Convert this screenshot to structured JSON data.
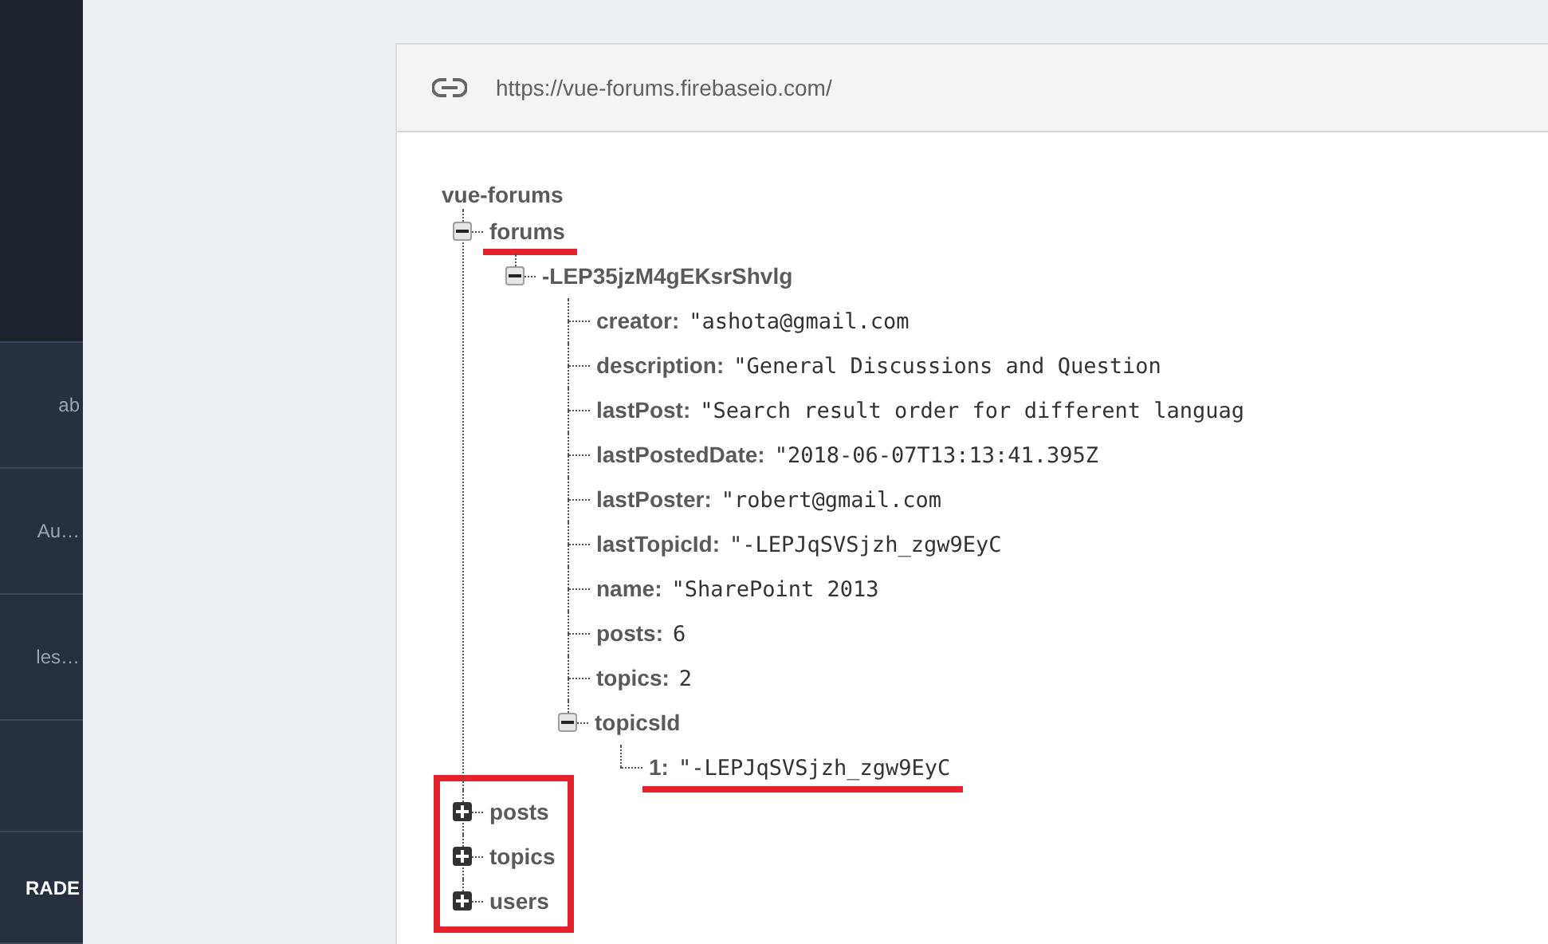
{
  "sidebar": {
    "items": [
      {
        "label": "ab",
        "kind": "link"
      },
      {
        "label": "Au…",
        "kind": "link"
      },
      {
        "label": "les…",
        "kind": "link"
      },
      {
        "label": "RADE",
        "kind": "action"
      }
    ]
  },
  "database": {
    "url": "https://vue-forums.firebaseio.com/",
    "tree": {
      "key": "vue-forums",
      "children": [
        {
          "key": "forums",
          "expanded": true,
          "underlined": true,
          "highlighted": false,
          "children": [
            {
              "key": "-LEP35jzM4gEKsrShvlg",
              "expanded": true,
              "underlined": false,
              "highlighted": false,
              "children": [
                {
                  "key": "creator:",
                  "value": "\"ashota@gmail.com",
                  "underlined": false,
                  "highlighted": false
                },
                {
                  "key": "description:",
                  "value": "\"General Discussions and Question",
                  "underlined": false,
                  "highlighted": false
                },
                {
                  "key": "lastPost:",
                  "value": "\"Search result order for different languag",
                  "underlined": false,
                  "highlighted": false
                },
                {
                  "key": "lastPostedDate:",
                  "value": "\"2018-06-07T13:13:41.395Z",
                  "underlined": false,
                  "highlighted": false
                },
                {
                  "key": "lastPoster:",
                  "value": "\"robert@gmail.com",
                  "underlined": false,
                  "highlighted": false
                },
                {
                  "key": "lastTopicId:",
                  "value": "\"-LEPJqSVSjzh_zgw9EyC",
                  "underlined": false,
                  "highlighted": false
                },
                {
                  "key": "name:",
                  "value": "\"SharePoint 2013",
                  "underlined": false,
                  "highlighted": false
                },
                {
                  "key": "posts:",
                  "value": "6",
                  "underlined": false,
                  "highlighted": false
                },
                {
                  "key": "topics:",
                  "value": "2",
                  "underlined": false,
                  "highlighted": false
                },
                {
                  "key": "topicsId",
                  "expanded": true,
                  "underlined": false,
                  "highlighted": false,
                  "children": [
                    {
                      "key": "1:",
                      "value": "\"-LEPJqSVSjzh_zgw9EyC",
                      "underlined": true,
                      "highlighted": false
                    }
                  ]
                }
              ]
            }
          ]
        },
        {
          "key": "posts",
          "expanded": false,
          "underlined": false,
          "highlighted": true
        },
        {
          "key": "topics",
          "expanded": false,
          "underlined": false,
          "highlighted": true
        },
        {
          "key": "users",
          "expanded": false,
          "underlined": false,
          "highlighted": true
        }
      ]
    }
  }
}
